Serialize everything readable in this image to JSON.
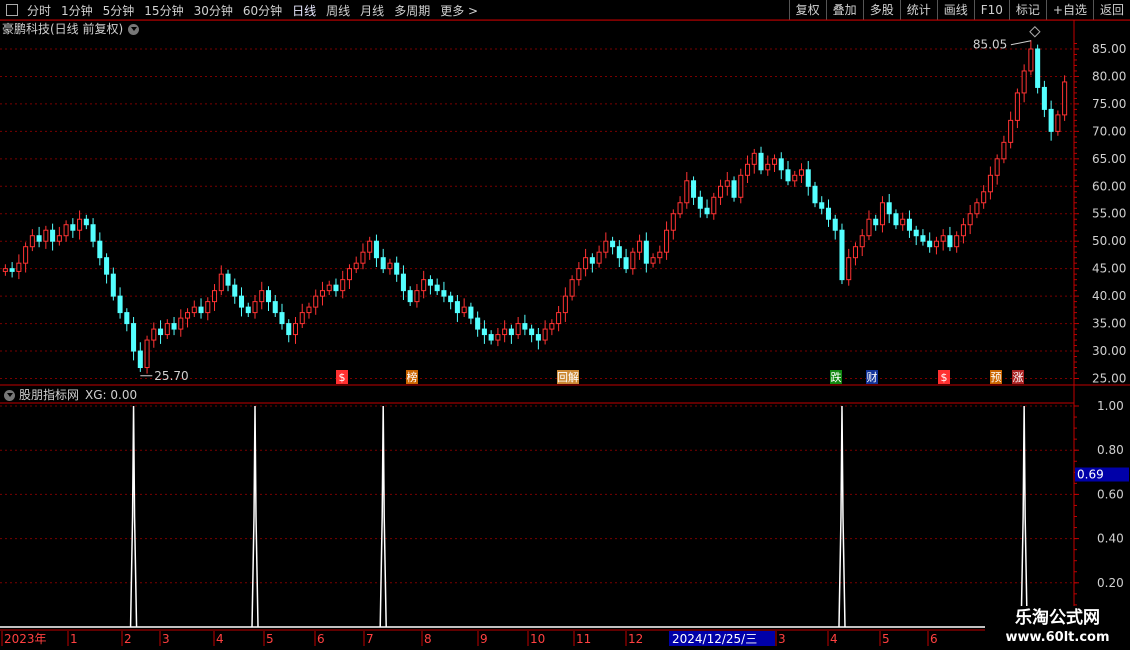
{
  "toolbar": {
    "periods": [
      "分时",
      "1分钟",
      "5分钟",
      "15分钟",
      "30分钟",
      "60分钟",
      "日线",
      "周线",
      "月线",
      "多周期",
      "更多 >"
    ],
    "active_period": "日线",
    "actions": [
      "复权",
      "叠加",
      "多股",
      "统计",
      "画线",
      "F10",
      "标记",
      "+自选",
      "返回"
    ]
  },
  "main_chart": {
    "title": "豪鹏科技(日线 前复权)",
    "high_label": "85.05",
    "low_label": "25.70",
    "yaxis": [
      "85.00",
      "80.00",
      "75.00",
      "70.00",
      "65.00",
      "60.00",
      "55.00",
      "50.00",
      "45.00",
      "40.00",
      "35.00",
      "30.00",
      "25.00"
    ],
    "events": [
      "$",
      "榜",
      "回解",
      "跌",
      "财",
      "$",
      "预",
      "涨"
    ]
  },
  "indicator": {
    "title": "股朋指标网",
    "value_label": "XG: 0.00",
    "yaxis": [
      "1.00",
      "0.80",
      "0.60",
      "0.40",
      "0.20"
    ],
    "current_value": "0.69"
  },
  "xaxis": {
    "labels": [
      "2023年",
      "1",
      "2",
      "3",
      "4",
      "5",
      "6",
      "7",
      "8",
      "9",
      "10",
      "11",
      "12",
      "2024/12/25/三",
      "3",
      "4",
      "5",
      "6"
    ]
  },
  "watermark": {
    "line1": "乐淘公式网",
    "line2": "www.60lt.com"
  },
  "colors": {
    "up": "#ff3333",
    "down": "#54ffff",
    "grid": "#7a0000",
    "axis": "#c00000",
    "signal": "#ffffff"
  },
  "chart_data": {
    "type": "candlestick",
    "ylim": [
      24,
      87
    ],
    "close": [
      45,
      44.5,
      46,
      49,
      51,
      50,
      52,
      50,
      51,
      53,
      52,
      54,
      53,
      50,
      47,
      44,
      40,
      37,
      35,
      30,
      27,
      32,
      34,
      33,
      35,
      34,
      36,
      37,
      38,
      37,
      39,
      41,
      44,
      42,
      40,
      38,
      37,
      39,
      41,
      39,
      37,
      35,
      33,
      35,
      37,
      38,
      40,
      41,
      42,
      41,
      43,
      45,
      46,
      48,
      50,
      47,
      45,
      46,
      44,
      41,
      39,
      41,
      43,
      42,
      41,
      40,
      39,
      37,
      38,
      36,
      34,
      33,
      32,
      33,
      34,
      33,
      35,
      34,
      33,
      32,
      34,
      35,
      37,
      40,
      43,
      45,
      47,
      46,
      48,
      50,
      49,
      47,
      45,
      48,
      50,
      46,
      47,
      48,
      52,
      55,
      57,
      61,
      58,
      56,
      55,
      58,
      60,
      61,
      58,
      62,
      64,
      66,
      63,
      64,
      65,
      63,
      61,
      62,
      63,
      60,
      57,
      56,
      54,
      52,
      43,
      47,
      49,
      51,
      54,
      53,
      57,
      55,
      53,
      54,
      52,
      51,
      50,
      49,
      50,
      51,
      49,
      51,
      53,
      55,
      57,
      59,
      62,
      65,
      68,
      72,
      77,
      81,
      85,
      78,
      74,
      70,
      73,
      79
    ],
    "signals": [
      0.0,
      0.0,
      0.0,
      0.0,
      0.0,
      0.0,
      0.0,
      0.0,
      0.0,
      0.0,
      0.0,
      0.0,
      0.0,
      0.0,
      0.0,
      0.0,
      0.0,
      0.0,
      0.0,
      1.0,
      0.0,
      0.0,
      0.0,
      0.0,
      0.0,
      0.0,
      0.0,
      0.0,
      0.0,
      0.0,
      0.0,
      0.0,
      0.0,
      0.0,
      0.0,
      0.0,
      0.0,
      1.0,
      0.0,
      0.0,
      0.0,
      0.0,
      0.0,
      0.0,
      0.0,
      0.0,
      0.0,
      0.0,
      0.0,
      0.0,
      0.0,
      0.0,
      0.0,
      0.0,
      0.0,
      0.0,
      1.0,
      0.0,
      0.0,
      0.0,
      0.0,
      0.0,
      0.0,
      0.0,
      0.0,
      0.0,
      0.0,
      0.0,
      0.0,
      0.0,
      0.0,
      0.0,
      0.0,
      0.0,
      0.0,
      0.0,
      0.0,
      0.0,
      0.0,
      0.0,
      0.0,
      0.0,
      0.0,
      0.0,
      0.0,
      0.0,
      0.0,
      0.0,
      0.0,
      0.0,
      0.0,
      0.0,
      0.0,
      0.0,
      0.0,
      0.0,
      0.0,
      0.0,
      0.0,
      0.0,
      0.0,
      0.0,
      0.0,
      0.0,
      0.0,
      0.0,
      0.0,
      0.0,
      0.0,
      0.0,
      0.0,
      0.0,
      0.0,
      0.0,
      0.0,
      0.0,
      0.0,
      0.0,
      0.0,
      0.0,
      0.0,
      0.0,
      0.0,
      0.0,
      1.0,
      0.0,
      0.0,
      0.0,
      0.0,
      0.0,
      0.0,
      0.0,
      0.0,
      0.0,
      0.0,
      0.0,
      0.0,
      0.0,
      0.0,
      0.0,
      0.0,
      0.0,
      0.0,
      0.0,
      0.0,
      0.0,
      0.0,
      0.0,
      0.0,
      0.0,
      0.0,
      1.0,
      0.0,
      0.0,
      0.0,
      0.0,
      0.0
    ]
  }
}
